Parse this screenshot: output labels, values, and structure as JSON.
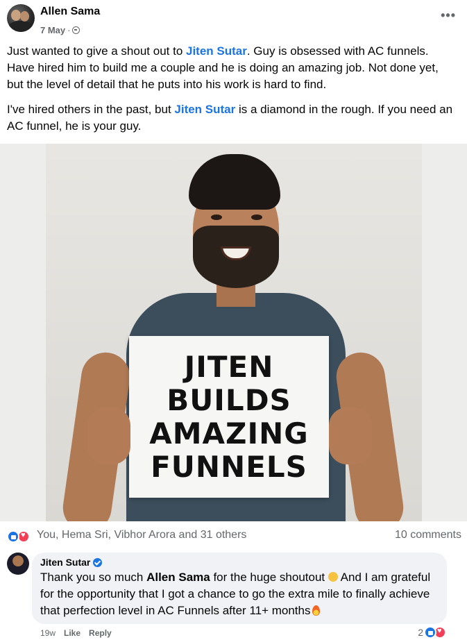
{
  "post": {
    "author": "Allen Sama",
    "date": "7 May",
    "dot": "·",
    "more": "•••",
    "paragraphs": [
      {
        "before": "Just wanted to give a shout out to ",
        "mention": "Jiten Sutar",
        "after": ".  Guy is obsessed with AC funnels. Have hired him to build me a couple and he is doing an amazing job. Not done yet, but the level of detail that he puts into his work is hard to find."
      },
      {
        "before": "I've hired others in the past, but ",
        "mention": "Jiten Sutar",
        "after": " is a diamond in the rough. If you need an AC funnel, he is your guy."
      }
    ],
    "sign_lines": [
      "JITEN",
      "BUILDS",
      "AMAZING",
      "FUNNELS"
    ]
  },
  "reactions": {
    "icons": [
      "like-icon",
      "love-icon"
    ],
    "reactors": "You, Hema Sri, Vibhor Arora and 31 others",
    "comments": "10 comments"
  },
  "comment": {
    "author": "Jiten Sutar",
    "text_part1": "Thank you so much ",
    "text_mention": "Allen Sama",
    "text_part2": " for the huge shoutout ",
    "text_part3": " And I am grateful for the opportunity that I got a chance to go the extra mile to finally achieve that perfection level in AC Funnels after 11+ months",
    "time": "19w",
    "like_label": "Like",
    "reply_label": "Reply",
    "reaction_count": "2"
  },
  "colors": {
    "mention": "#1b74e4",
    "like": "#1b74e4",
    "love": "#f33e58",
    "muted": "#65676b",
    "bubble": "#f0f2f5"
  }
}
